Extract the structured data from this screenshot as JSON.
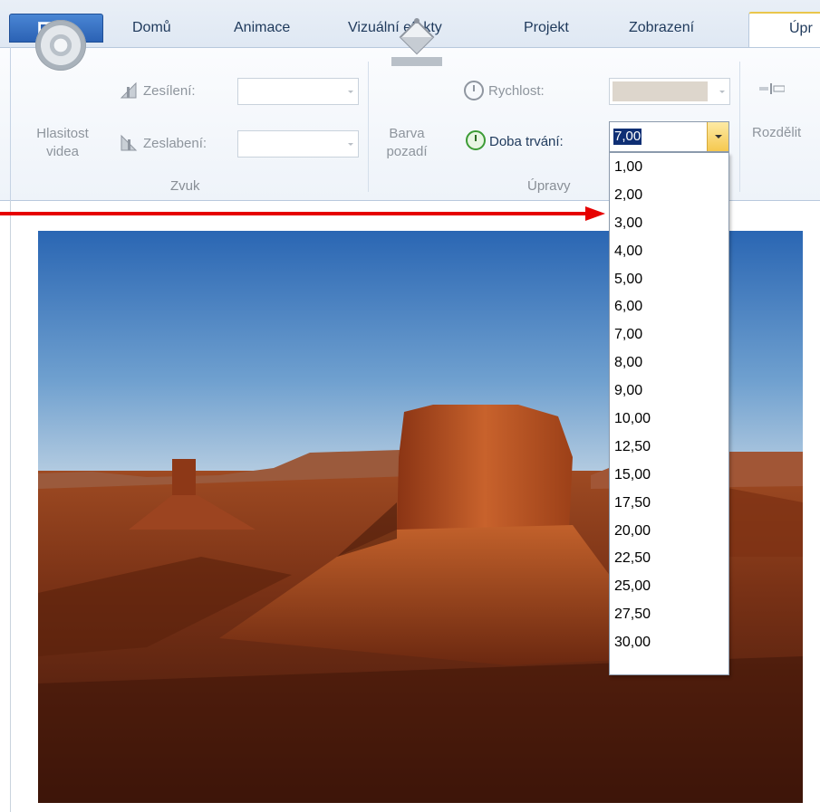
{
  "tabs": [
    {
      "label": "Domů"
    },
    {
      "label": "Animace"
    },
    {
      "label": "Vizuální efekty"
    },
    {
      "label": "Projekt"
    },
    {
      "label": "Zobrazení"
    },
    {
      "label": "Úpr"
    }
  ],
  "ribbon": {
    "video_volume_label": "Hlasitost videa",
    "fade_in_label": "Zesílení:",
    "fade_out_label": "Zeslabení:",
    "sound_group": "Zvuk",
    "bg_color_label": "Barva pozadí",
    "speed_label": "Rychlost:",
    "duration_label": "Doba trvání:",
    "duration_value": "7,00",
    "edit_group": "Úpravy",
    "split_label": "Rozdělit"
  },
  "duration_options": [
    "1,00",
    "2,00",
    "3,00",
    "4,00",
    "5,00",
    "6,00",
    "7,00",
    "8,00",
    "9,00",
    "10,00",
    "12,50",
    "15,00",
    "17,50",
    "20,00",
    "22,50",
    "25,00",
    "27,50",
    "30,00"
  ],
  "colors": {
    "accent_tab": "#e9c64c",
    "selection": "#0f2f74",
    "annotation_arrow": "#e60000"
  }
}
